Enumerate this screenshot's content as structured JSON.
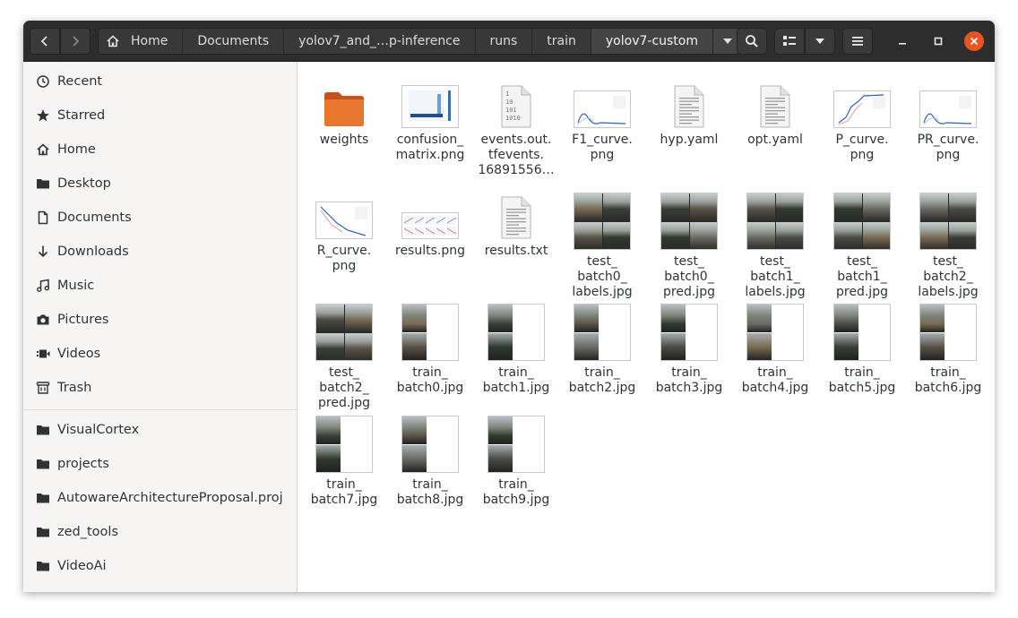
{
  "window": {
    "title": "yolov7-custom"
  },
  "headerbar": {
    "breadcrumbs": [
      "Home",
      "Documents",
      "yolov7_and_…p-inference",
      "runs",
      "train",
      "yolov7-custom"
    ]
  },
  "sidebar": {
    "places": [
      {
        "label": "Recent",
        "icon": "clock-icon"
      },
      {
        "label": "Starred",
        "icon": "star-icon"
      },
      {
        "label": "Home",
        "icon": "home-icon"
      },
      {
        "label": "Desktop",
        "icon": "folder-icon"
      },
      {
        "label": "Documents",
        "icon": "document-icon"
      },
      {
        "label": "Downloads",
        "icon": "download-icon"
      },
      {
        "label": "Music",
        "icon": "music-icon"
      },
      {
        "label": "Pictures",
        "icon": "camera-icon"
      },
      {
        "label": "Videos",
        "icon": "video-icon"
      },
      {
        "label": "Trash",
        "icon": "trash-icon"
      }
    ],
    "bookmarks": [
      {
        "label": "VisualCortex",
        "icon": "folder-icon"
      },
      {
        "label": "projects",
        "icon": "folder-icon"
      },
      {
        "label": "AutowareArchitectureProposal.proj",
        "icon": "folder-icon"
      },
      {
        "label": "zed_tools",
        "icon": "folder-icon"
      },
      {
        "label": "VideoAi",
        "icon": "folder-icon"
      }
    ]
  },
  "files": [
    {
      "name": "weights",
      "kind": "folder"
    },
    {
      "name": "confusion_\nmatrix.png",
      "kind": "matrix"
    },
    {
      "name": "events.out.\ntfevents.\n16891556…",
      "kind": "binary"
    },
    {
      "name": "F1_curve.\npng",
      "kind": "curve"
    },
    {
      "name": "hyp.yaml",
      "kind": "text"
    },
    {
      "name": "opt.yaml",
      "kind": "text"
    },
    {
      "name": "P_curve.\npng",
      "kind": "pcurve"
    },
    {
      "name": "PR_curve.\npng",
      "kind": "curve"
    },
    {
      "name": "R_curve.\npng",
      "kind": "rcurve"
    },
    {
      "name": "results.png",
      "kind": "results"
    },
    {
      "name": "results.txt",
      "kind": "text"
    },
    {
      "name": "test_\nbatch0_\nlabels.jpg",
      "kind": "grid"
    },
    {
      "name": "test_\nbatch0_\npred.jpg",
      "kind": "grid"
    },
    {
      "name": "test_\nbatch1_\nlabels.jpg",
      "kind": "grid"
    },
    {
      "name": "test_\nbatch1_\npred.jpg",
      "kind": "grid"
    },
    {
      "name": "test_\nbatch2_\nlabels.jpg",
      "kind": "grid"
    },
    {
      "name": "test_\nbatch2_\npred.jpg",
      "kind": "grid"
    },
    {
      "name": "train_\nbatch0.jpg",
      "kind": "partial"
    },
    {
      "name": "train_\nbatch1.jpg",
      "kind": "partial"
    },
    {
      "name": "train_\nbatch2.jpg",
      "kind": "partial"
    },
    {
      "name": "train_\nbatch3.jpg",
      "kind": "partial"
    },
    {
      "name": "train_\nbatch4.jpg",
      "kind": "partial"
    },
    {
      "name": "train_\nbatch5.jpg",
      "kind": "partial"
    },
    {
      "name": "train_\nbatch6.jpg",
      "kind": "partial"
    },
    {
      "name": "train_\nbatch7.jpg",
      "kind": "partial"
    },
    {
      "name": "train_\nbatch8.jpg",
      "kind": "partial"
    },
    {
      "name": "train_\nbatch9.jpg",
      "kind": "partial"
    }
  ],
  "binary_icon_lines": [
    "1",
    "10",
    "101",
    "1010"
  ],
  "colors": {
    "accent": "#e95420",
    "folder": "#e9762f",
    "headerbar": "#2d2d2d",
    "sidebar": "#f6f5f4"
  }
}
